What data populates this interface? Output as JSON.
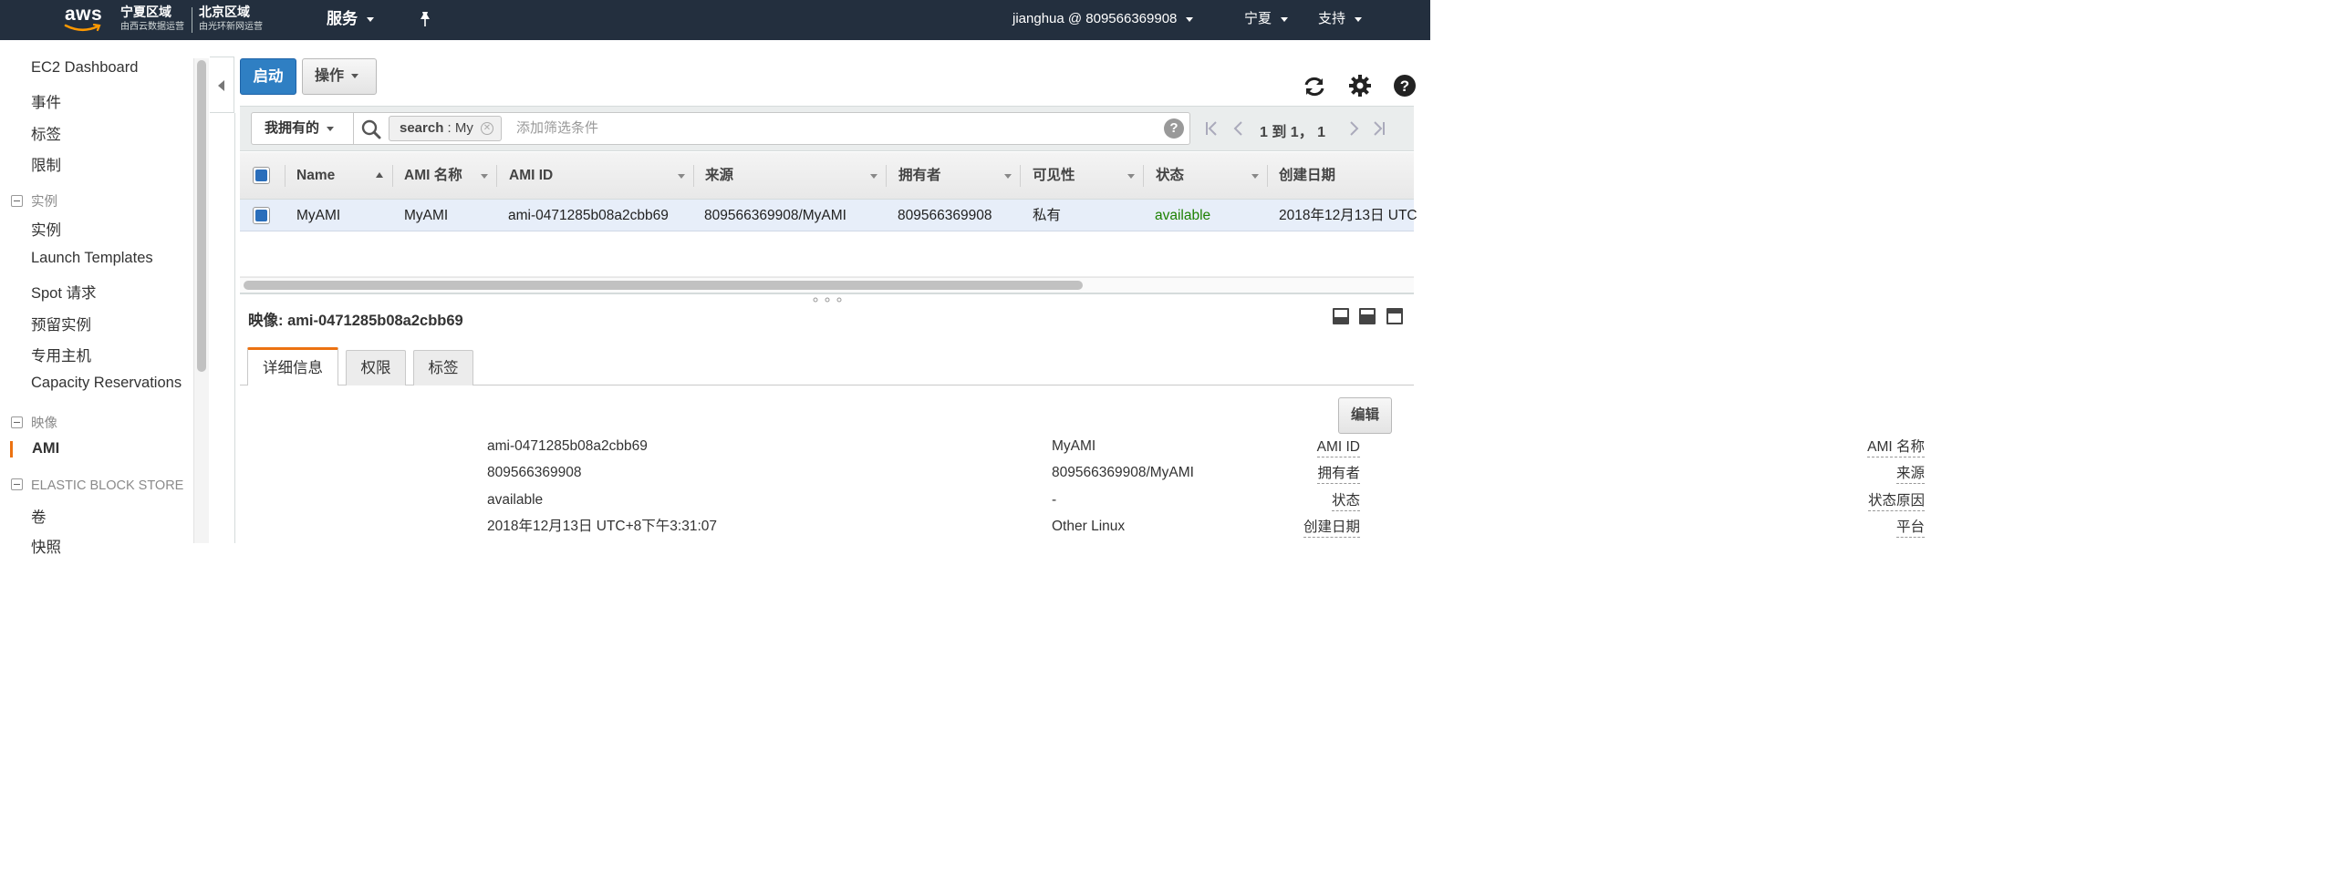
{
  "topnav": {
    "brand": "aws",
    "region1_name": "宁夏区域",
    "region1_operator": "由西云数据运营",
    "region2_name": "北京区域",
    "region2_operator": "由光环新网运营",
    "services_label": "服务",
    "account_label": "jianghua @ 809566369908",
    "region_label": "宁夏",
    "support_label": "支持",
    "icons": [
      "caret-down-icon",
      "pin-icon"
    ]
  },
  "sidebar": {
    "items": [
      "EC2 Dashboard",
      "事件",
      "标签",
      "限制"
    ],
    "section_instances": {
      "header": "实例",
      "items": [
        "实例",
        "Launch Templates",
        "Spot 请求",
        "预留实例",
        "专用主机",
        "Capacity Reservations"
      ]
    },
    "section_images": {
      "header": "映像",
      "items": [
        "AMI"
      ],
      "active": "AMI"
    },
    "section_ebs": {
      "header": "ELASTIC BLOCK STORE",
      "items": [
        "卷",
        "快照"
      ]
    },
    "accent_color": "#ec7211"
  },
  "toolbar": {
    "launch_label": "启动",
    "actions_label": "操作",
    "icons": [
      "refresh-icon",
      "gear-icon",
      "help-icon"
    ]
  },
  "filter": {
    "owner_select": "我拥有的",
    "token_key": "search",
    "token_sep": " : ",
    "token_value": "My",
    "placeholder": "添加筛选条件",
    "help": "?",
    "pager_text": "1 到 1， 1"
  },
  "table": {
    "columns": [
      "Name",
      "AMI 名称",
      "AMI ID",
      "来源",
      "拥有者",
      "可见性",
      "状态",
      "创建日期"
    ],
    "rows": [
      {
        "name": "MyAMI",
        "ami_name": "MyAMI",
        "ami_id": "ami-0471285b08a2cbb69",
        "source": "809566369908/MyAMI",
        "owner": "809566369908",
        "visibility": "私有",
        "status": "available",
        "created": "2018年12月13日 UTC"
      }
    ],
    "status_color": "#1d8102"
  },
  "details": {
    "title": "映像: ami-0471285b08a2cbb69",
    "tabs": [
      "详细信息",
      "权限",
      "标签"
    ],
    "edit_label": "编辑",
    "left": [
      {
        "label": "AMI ID",
        "value": "ami-0471285b08a2cbb69"
      },
      {
        "label": "拥有者",
        "value": "809566369908"
      },
      {
        "label": "状态",
        "value": "available"
      },
      {
        "label": "创建日期",
        "value": "2018年12月13日 UTC+8下午3:31:07"
      }
    ],
    "right": [
      {
        "label": "AMI 名称",
        "value": "MyAMI"
      },
      {
        "label": "来源",
        "value": "809566369908/MyAMI"
      },
      {
        "label": "状态原因",
        "value": "-"
      },
      {
        "label": "平台",
        "value": "Other Linux"
      }
    ]
  }
}
